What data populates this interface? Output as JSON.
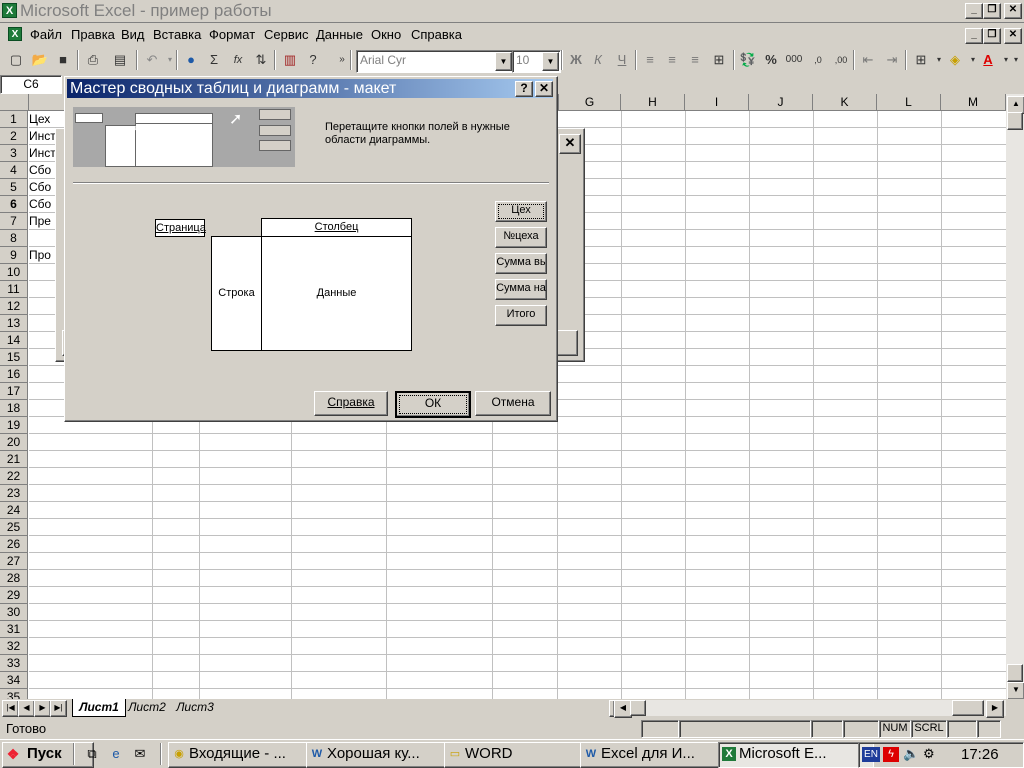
{
  "window": {
    "title": "Microsoft Excel - пример работы",
    "minimize": "_",
    "restore": "❐",
    "close": "✕"
  },
  "menu": {
    "items": [
      "Файл",
      "Правка",
      "Вид",
      "Вставка",
      "Формат",
      "Сервис",
      "Данные",
      "Окно",
      "Справка"
    ]
  },
  "toolbar": {
    "font_name": "Arial Cyr",
    "font_size": "10",
    "bold": "Ж",
    "italic": "К",
    "underline": "Ч",
    "sigma": "Σ",
    "fx": "fx",
    "percent": "%",
    "thousands": "000"
  },
  "formula_bar": {
    "name_box": "C6"
  },
  "grid": {
    "column_headers": [
      "G",
      "H",
      "I",
      "J",
      "K",
      "L",
      "M"
    ],
    "row_numbers": [
      "1",
      "2",
      "3",
      "4",
      "5",
      "6",
      "7",
      "8",
      "9",
      "10",
      "11",
      "12",
      "13",
      "14",
      "15",
      "16",
      "17",
      "18",
      "19",
      "20",
      "21",
      "22",
      "23",
      "24",
      "25",
      "26",
      "27",
      "28",
      "29",
      "30",
      "31",
      "32",
      "33",
      "34",
      "35"
    ],
    "cells": [
      "Цех",
      "Инст",
      "Инст",
      "Сбо",
      "Сбо",
      "Сбо",
      "Пре",
      "",
      "Про"
    ]
  },
  "sheet_tabs": [
    "Лист1",
    "Лист2",
    "Лист3"
  ],
  "status": {
    "ready": "Готово",
    "num": "NUM",
    "scrl": "SCRL"
  },
  "dialog": {
    "title": "Мастер сводных таблиц и диаграмм - макет",
    "help_icon": "?",
    "close_icon": "✕",
    "instruction": "Перетащите кнопки полей в нужные области диаграммы.",
    "zones": {
      "page": "Страница",
      "column": "Столбец",
      "row": "Строка",
      "data": "Данные"
    },
    "fields": [
      "Цех",
      "№цеха",
      "Сумма вь",
      "Сумма на",
      "Итого"
    ],
    "buttons": {
      "help": "Справка",
      "ok": "ОК",
      "cancel": "Отмена"
    }
  },
  "taskbar": {
    "start": "Пуск",
    "tasks": [
      "Входящие - ...",
      "Хорошая ку...",
      "WORD",
      "Excel для И...",
      "Microsoft E..."
    ],
    "lang": "EN",
    "clock": "17:26"
  }
}
